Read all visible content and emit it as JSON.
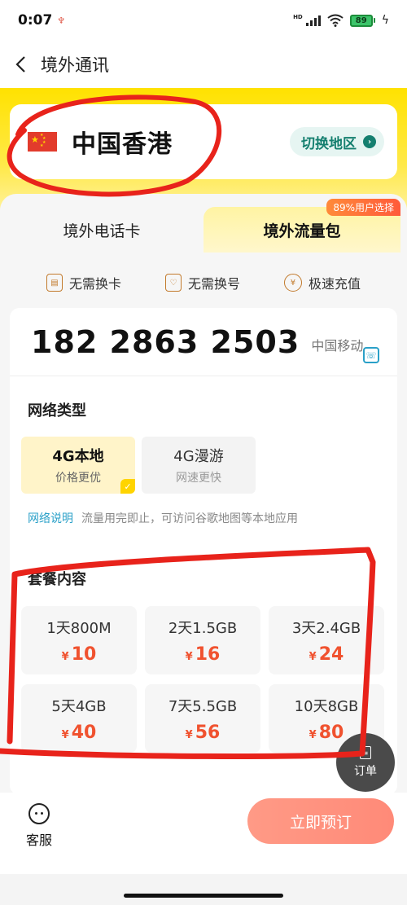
{
  "status_bar": {
    "time": "0:07",
    "network_label": "HD",
    "battery": "89"
  },
  "nav": {
    "title": "境外通讯"
  },
  "region": {
    "name": "中国香港",
    "switch_label": "切换地区"
  },
  "tabs": [
    {
      "label": "境外电话卡"
    },
    {
      "label": "境外流量包",
      "badge": "89%用户选择"
    }
  ],
  "features": [
    {
      "label": "无需换卡",
      "icon": "sim-card-icon"
    },
    {
      "label": "无需换号",
      "icon": "phone-shield-icon"
    },
    {
      "label": "极速充值",
      "icon": "yen-coin-icon"
    }
  ],
  "phone": {
    "number": "182 2863 2503",
    "carrier": "中国移动"
  },
  "network": {
    "title": "网络类型",
    "options": [
      {
        "title": "4G本地",
        "subtitle": "价格更优",
        "selected": true
      },
      {
        "title": "4G漫游",
        "subtitle": "网速更快",
        "selected": false
      }
    ],
    "desc_link": "网络说明",
    "desc": "流量用完即止，可访问谷歌地图等本地应用"
  },
  "packages": {
    "title": "套餐内容",
    "currency": "¥",
    "items": [
      {
        "name": "1天800M",
        "price": "10"
      },
      {
        "name": "2天1.5GB",
        "price": "16"
      },
      {
        "name": "3天2.4GB",
        "price": "24"
      },
      {
        "name": "5天4GB",
        "price": "40"
      },
      {
        "name": "7天5.5GB",
        "price": "56"
      },
      {
        "name": "10天8GB",
        "price": "80"
      }
    ]
  },
  "order_fab": {
    "label": "订单"
  },
  "bottom": {
    "customer_service": "客服",
    "book_button": "立即预订"
  },
  "colors": {
    "brand_yellow": "#ffe200",
    "price_red": "#f0522f",
    "teal": "#147f6f",
    "annotation_red": "#e8231b"
  }
}
